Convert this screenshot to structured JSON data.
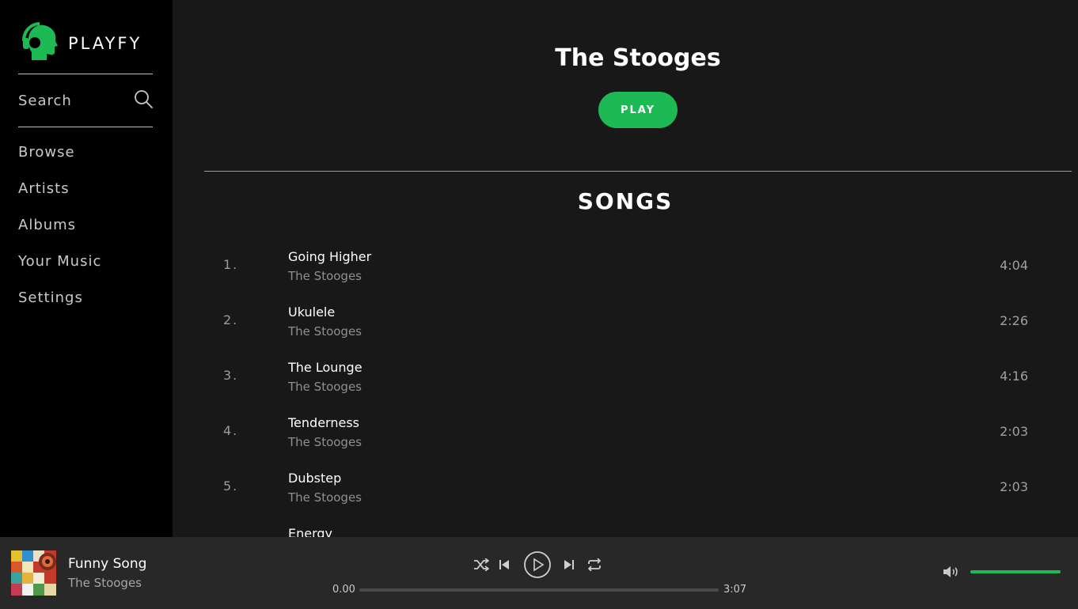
{
  "brand": {
    "name": "PLAYFY",
    "accent": "#1db954"
  },
  "sidebar": {
    "search_label": "Search",
    "items": [
      {
        "label": "Browse"
      },
      {
        "label": "Artists"
      },
      {
        "label": "Albums"
      },
      {
        "label": "Your Music"
      },
      {
        "label": "Settings"
      }
    ]
  },
  "main": {
    "artist_name": "The Stooges",
    "play_label": "PLAY",
    "songs_heading": "SONGS",
    "songs": [
      {
        "num": "1.",
        "title": "Going Higher",
        "artist": "The Stooges",
        "duration": "4:04"
      },
      {
        "num": "2.",
        "title": "Ukulele",
        "artist": "The Stooges",
        "duration": "2:26"
      },
      {
        "num": "3.",
        "title": "The Lounge",
        "artist": "The Stooges",
        "duration": "4:16"
      },
      {
        "num": "4.",
        "title": "Tenderness",
        "artist": "The Stooges",
        "duration": "2:03"
      },
      {
        "num": "5.",
        "title": "Dubstep",
        "artist": "The Stooges",
        "duration": "2:03"
      },
      {
        "num": "",
        "title": "Energy",
        "artist": "",
        "duration": ""
      }
    ]
  },
  "player": {
    "now_playing_title": "Funny Song",
    "now_playing_artist": "The Stooges",
    "current_time": "0.00",
    "total_time": "3:07",
    "progress": 0.0,
    "volume": 1.0,
    "icons": [
      "shuffle-icon",
      "previous-icon",
      "play-icon",
      "next-icon",
      "repeat-icon",
      "volume-icon"
    ]
  }
}
